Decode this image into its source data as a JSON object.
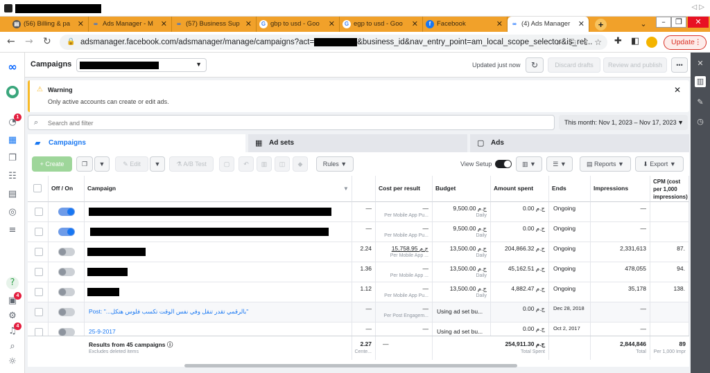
{
  "browser": {
    "tabs": [
      {
        "icon": "billing-icon",
        "label": "(56) Billing & pa"
      },
      {
        "icon": "meta-icon",
        "label": "Ads Manager - M"
      },
      {
        "icon": "meta-icon",
        "label": "(57) Business Sup"
      },
      {
        "icon": "google-icon",
        "label": "gbp to usd - Goo"
      },
      {
        "icon": "google-icon",
        "label": "egp to usd - Goo"
      },
      {
        "icon": "facebook-icon",
        "label": "Facebook"
      },
      {
        "icon": "meta-icon",
        "label": "(4) Ads Manager"
      }
    ],
    "active_tab": 6,
    "url_prefix": "adsmanager.facebook.com/adsmanager/manage/campaigns?act=",
    "url_suffix": "&business_id&nav_entry_point=am_local_scope_selector&is_rel...",
    "update_label": "Update",
    "colors": {
      "tab_bar": "#f1a12a",
      "update": "#d93025"
    }
  },
  "left_nav": {
    "badges": {
      "notifications_top": "1",
      "events": "4",
      "alerts": "4"
    }
  },
  "header": {
    "title": "Campaigns",
    "updated_text": "Updated just now",
    "discard_label": "Discard drafts",
    "review_label": "Review and publish",
    "more_label": "•••"
  },
  "warning": {
    "title": "Warning",
    "message": "Only active accounts can create or edit ads."
  },
  "search": {
    "placeholder": "Search and filter"
  },
  "date_range": "This month: Nov 1, 2023 – Nov 17, 2023",
  "level_tabs": [
    {
      "label": "Campaigns"
    },
    {
      "label": "Ad sets"
    },
    {
      "label": "Ads"
    }
  ],
  "toolbar": {
    "create": "+ Create",
    "edit": "Edit",
    "ab_test": "A/B Test",
    "rules": "Rules",
    "view_setup": "View Setup",
    "reports": "Reports",
    "export": "Export"
  },
  "columns": [
    "Off / On",
    "Campaign",
    "Cost per result",
    "Budget",
    "Amount spent",
    "Ends",
    "Impressions",
    "CPM (cost per 1,000 impressions)"
  ],
  "rows": [
    {
      "on": true,
      "name": "",
      "results": "—",
      "cost": "—",
      "cost_sub": "Per Mobile App Pu...",
      "budget": "9,500.00 ج.م",
      "budget_sub": "Daily",
      "spent": "0.00 ج.م",
      "ends": "Ongoing",
      "impressions": "—",
      "cpm": ""
    },
    {
      "on": true,
      "name": "",
      "results": "—",
      "cost": "—",
      "cost_sub": "Per Mobile App Pu...",
      "budget": "9,500.00 ج.م",
      "budget_sub": "Daily",
      "spent": "0.00 ج.م",
      "ends": "Ongoing",
      "impressions": "—",
      "cpm": ""
    },
    {
      "on": false,
      "name": "",
      "results": "2.24",
      "cost": "15,758.95 ج.م",
      "cost_sub": "Per Mobile App ...",
      "budget": "13,500.00 ج.م",
      "budget_sub": "Daily",
      "spent": "204,866.32 ج.م",
      "ends": "Ongoing",
      "impressions": "2,331,613",
      "cpm": "87."
    },
    {
      "on": false,
      "name": "",
      "results": "1.36",
      "cost": "—",
      "cost_sub": "Per Mobile App ...",
      "budget": "13,500.00 ج.م",
      "budget_sub": "Daily",
      "spent": "45,162.51 ج.م",
      "ends": "Ongoing",
      "impressions": "478,055",
      "cpm": "94."
    },
    {
      "on": false,
      "name": "",
      "results": "1.12",
      "cost": "—",
      "cost_sub": "Per Mobile App Pu...",
      "budget": "13,500.00 ج.م",
      "budget_sub": "Daily",
      "spent": "4,882.47 ج.م",
      "ends": "Ongoing",
      "impressions": "35,178",
      "cpm": "138."
    },
    {
      "on": false,
      "name": "Post: \"...بالرقمي تقدر تنقل وفي نفس الوقت تكسب فلوس هتكل\"",
      "results": "—",
      "cost": "—",
      "cost_sub": "Per Post Engagem...",
      "budget": "Using ad set bu...",
      "budget_sub": "",
      "spent": "0.00 ج.م",
      "ends": "Dec 28, 2018",
      "impressions": "—",
      "cpm": ""
    },
    {
      "on": false,
      "name": "25-9-2017",
      "results": "—",
      "cost": "—",
      "cost_sub": "",
      "budget": "Using ad set bu...",
      "budget_sub": "",
      "spent": "0.00 ج.م",
      "ends": "Oct 2, 2017",
      "impressions": "—",
      "cpm": ""
    }
  ],
  "totals": {
    "label": "Results from 45 campaigns",
    "sub": "Excludes deleted items",
    "results": "2.27",
    "results_sub": "Cente...",
    "cost": "—",
    "spent": "254,911.30 ج.م",
    "spent_sub": "Total Spent",
    "impressions": "2,844,846",
    "impressions_sub": "Total",
    "cpm": "89",
    "cpm_sub": "Per 1,000 Impr"
  }
}
